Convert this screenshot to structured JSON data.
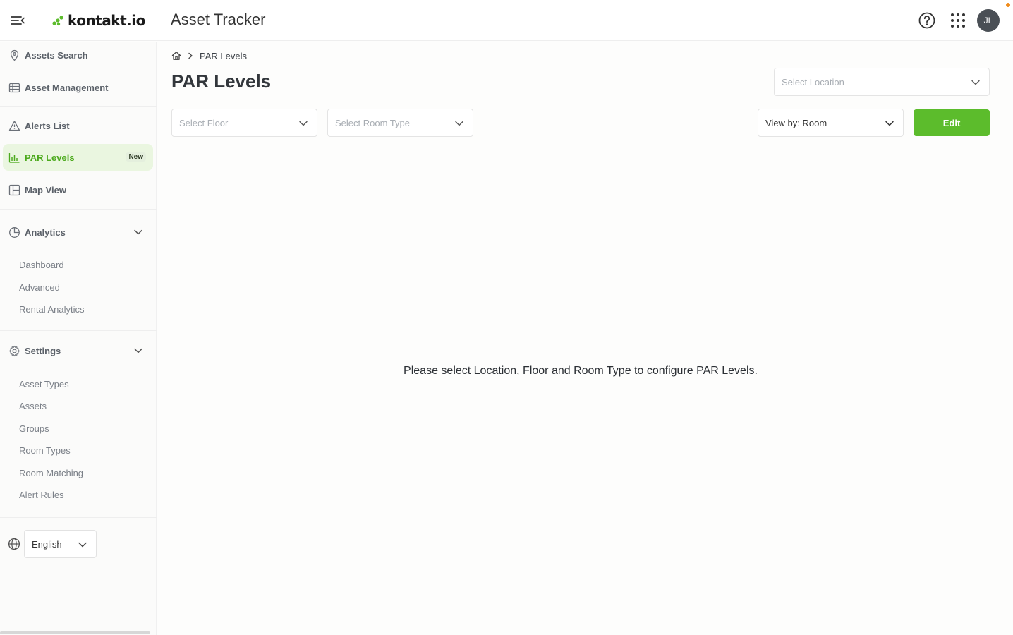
{
  "header": {
    "logo_text": "kontakt.io",
    "app_title": "Asset Tracker",
    "avatar_initials": "JL",
    "accent_color": "#5cbc2c"
  },
  "sidebar": {
    "items": [
      {
        "label": "Assets Search",
        "icon": "location-pin-icon"
      },
      {
        "label": "Asset Management",
        "icon": "table-icon"
      },
      {
        "label": "Alerts List",
        "icon": "warning-triangle-icon"
      },
      {
        "label": "PAR Levels",
        "icon": "bar-chart-icon",
        "badge": "New",
        "active": true
      },
      {
        "label": "Map View",
        "icon": "map-layout-icon"
      }
    ],
    "analytics": {
      "label": "Analytics",
      "icon": "pie-chart-icon",
      "sub_items": [
        "Dashboard",
        "Advanced",
        "Rental Analytics"
      ]
    },
    "settings": {
      "label": "Settings",
      "icon": "gear-icon",
      "sub_items": [
        "Asset Types",
        "Assets",
        "Groups",
        "Room Types",
        "Room Matching",
        "Alert Rules"
      ]
    },
    "language": {
      "value": "English",
      "icon": "globe-icon"
    }
  },
  "main": {
    "breadcrumb": {
      "current": "PAR Levels"
    },
    "title": "PAR Levels",
    "location_select": {
      "placeholder": "Select Location"
    },
    "floor_select": {
      "placeholder": "Select Floor"
    },
    "room_type_select": {
      "placeholder": "Select Room Type"
    },
    "view_by_select": {
      "value": "View by: Room"
    },
    "edit_label": "Edit",
    "empty_message": "Please select Location, Floor and Room Type to configure PAR Levels."
  }
}
